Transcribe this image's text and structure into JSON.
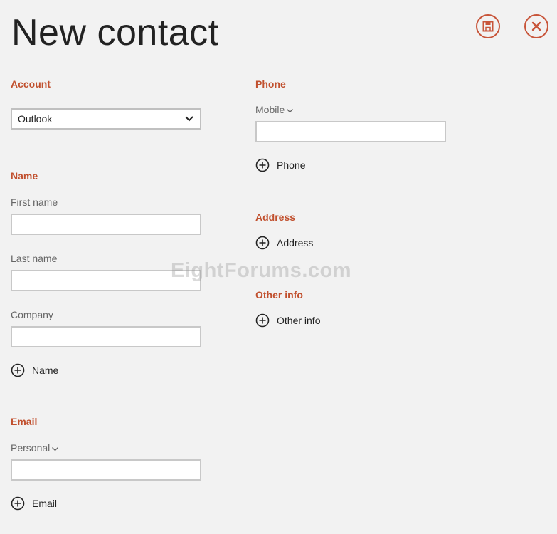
{
  "header": {
    "title": "New contact"
  },
  "actions": {
    "save_icon": "save-icon",
    "close_icon": "close-icon"
  },
  "colors": {
    "accent": "#c1502e",
    "icon_accent": "#c8553a",
    "background": "#f2f2f2"
  },
  "account": {
    "heading": "Account",
    "selected": "Outlook"
  },
  "name": {
    "heading": "Name",
    "first_label": "First name",
    "last_label": "Last name",
    "company_label": "Company",
    "add_label": "Name"
  },
  "email": {
    "heading": "Email",
    "type_label": "Personal",
    "add_label": "Email"
  },
  "phone": {
    "heading": "Phone",
    "type_label": "Mobile",
    "add_label": "Phone"
  },
  "address": {
    "heading": "Address",
    "add_label": "Address"
  },
  "other": {
    "heading": "Other info",
    "add_label": "Other info"
  },
  "watermark": "EightForums.com"
}
